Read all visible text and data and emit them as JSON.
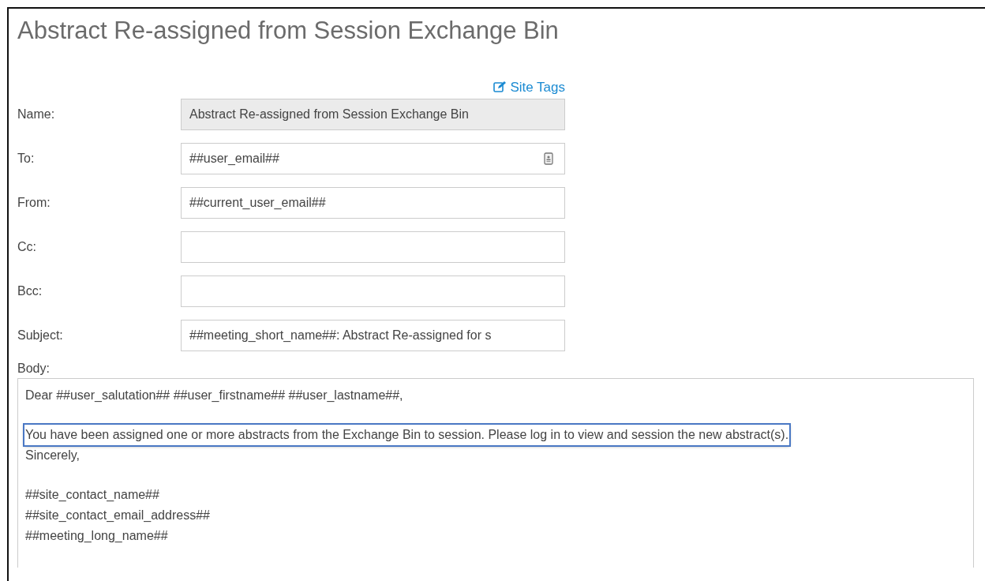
{
  "title": "Abstract Re-assigned from Session Exchange Bin",
  "site_tags_link": "Site Tags",
  "fields": [
    {
      "label": "Name:",
      "value": "Abstract Re-assigned from Session Exchange Bin",
      "disabled": true
    },
    {
      "label": "To:",
      "value": "##user_email##",
      "disabled": false,
      "kind": "contact"
    },
    {
      "label": "From:",
      "value": "##current_user_email##",
      "disabled": false
    },
    {
      "label": "Cc:",
      "disabled": false
    },
    {
      "label": "Bcc:",
      "disabled": false
    },
    {
      "label": "Subject:",
      "value": "##meeting_short_name##: Abstract Re-assigned for s",
      "disabled": false
    }
  ],
  "body": {
    "label": "Body:",
    "paragraphs": [
      {
        "lines": [
          {
            "text": "Dear ##user_salutation## ##user_firstname## ##user_lastname##,",
            "highlighted": false
          }
        ]
      },
      {
        "lines": [
          {
            "text": "You have been assigned one or more abstracts from the Exchange Bin to session. Please log in to view and session the new abstract(s).",
            "highlighted": true
          },
          {
            "text": "Sincerely,",
            "highlighted": false
          }
        ]
      },
      {
        "lines": [
          {
            "text": "##site_contact_name##",
            "highlighted": false
          },
          {
            "text": "##site_contact_email_address##",
            "highlighted": false
          },
          {
            "text": "##meeting_long_name##",
            "highlighted": false
          }
        ]
      }
    ]
  }
}
